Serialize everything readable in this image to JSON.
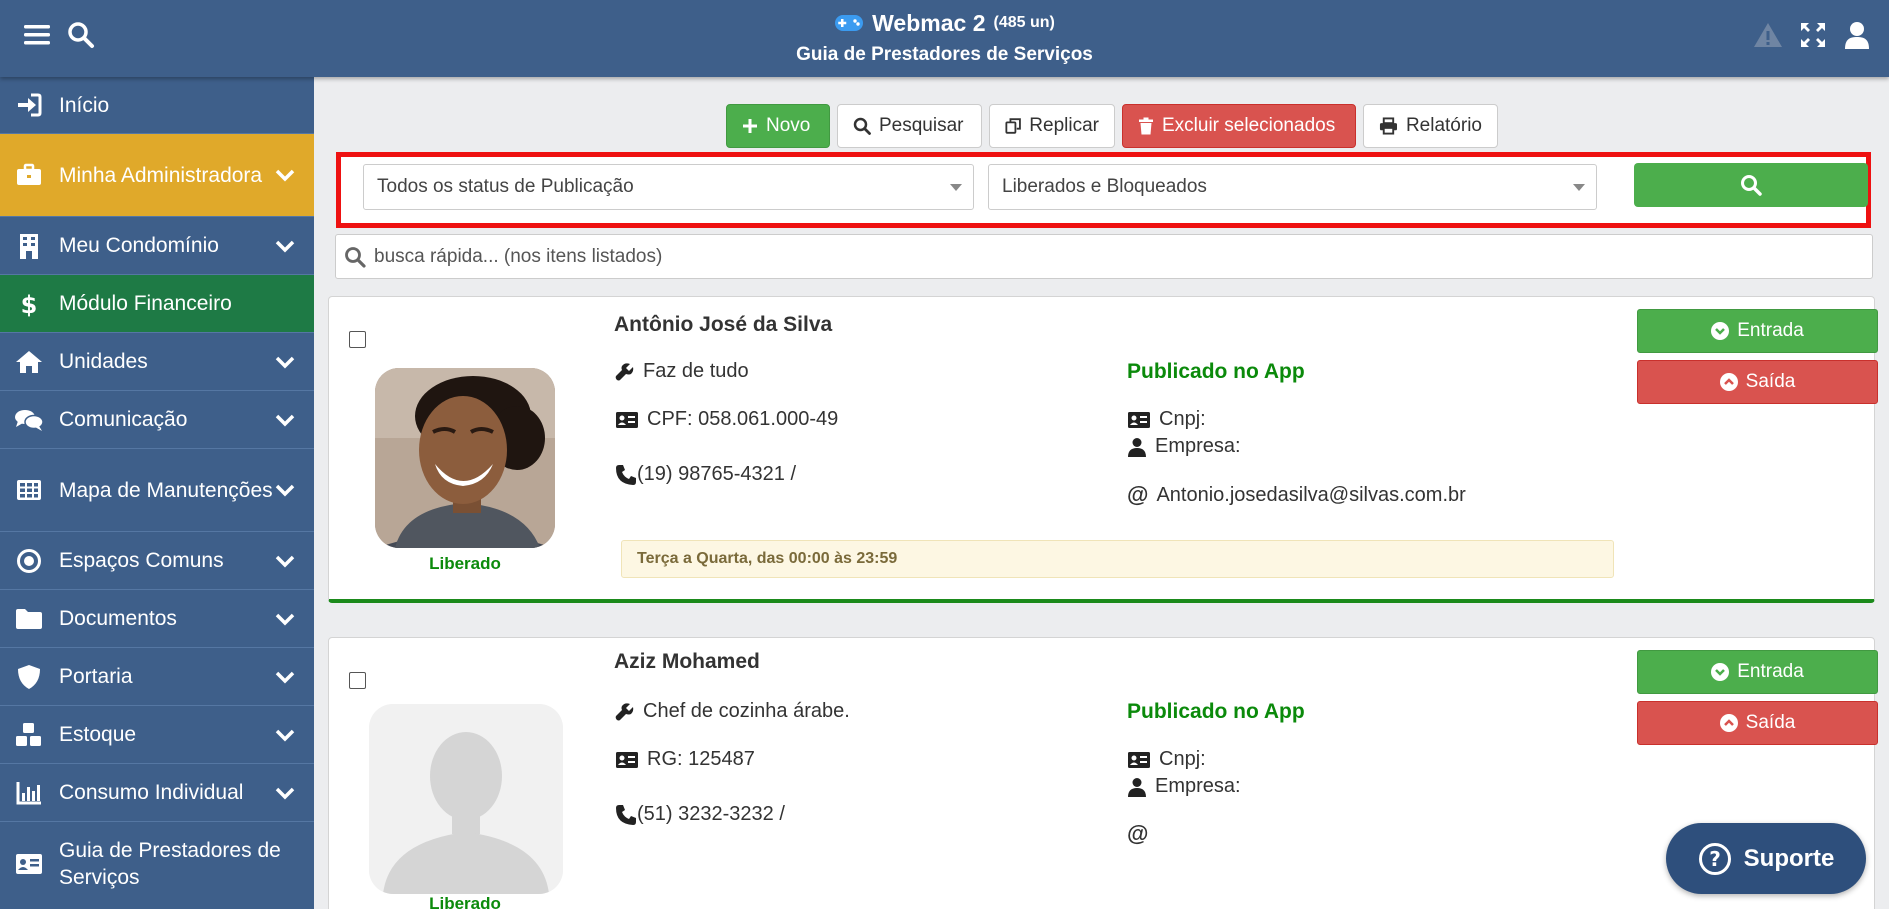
{
  "header": {
    "app_name": "Webmac 2",
    "units": "(485 un)",
    "subtitle": "Guia de Prestadores de Serviços"
  },
  "sidebar": {
    "items": [
      {
        "label": "Início",
        "icon": "sign-in-icon"
      },
      {
        "label": "Minha Administradora",
        "icon": "briefcase-icon",
        "active": true
      },
      {
        "label": "Meu Condomínio",
        "icon": "building-icon"
      },
      {
        "label": "Módulo Financeiro",
        "icon": "dollar-icon"
      },
      {
        "label": "Unidades",
        "icon": "home-icon"
      },
      {
        "label": "Comunicação",
        "icon": "comments-icon"
      },
      {
        "label": "Mapa de Manutenções",
        "icon": "table-icon"
      },
      {
        "label": "Espaços Comuns",
        "icon": "dot-circle-icon"
      },
      {
        "label": "Documentos",
        "icon": "folder-icon"
      },
      {
        "label": "Portaria",
        "icon": "shield-icon"
      },
      {
        "label": "Estoque",
        "icon": "cubes-icon"
      },
      {
        "label": "Consumo Individual",
        "icon": "chart-icon"
      },
      {
        "label": "Guia de Prestadores de Serviços",
        "icon": "id-card-icon"
      }
    ]
  },
  "toolbar": {
    "novo": "Novo",
    "pesquisar": "Pesquisar",
    "replicar": "Replicar",
    "excluir": "Excluir selecionados",
    "relatorio": "Relatório"
  },
  "filters": {
    "status_publicacao": "Todos os status de Publicação",
    "liberacao": "Liberados e Bloqueados"
  },
  "quick_search": {
    "placeholder": "busca rápida... (nos itens listados)"
  },
  "providers": [
    {
      "name": "Antônio José da Silva",
      "service": "Faz de tudo",
      "document": "CPF: 058.061.000-49",
      "phone": "(19) 98765-4321 /",
      "published": "Publicado no App",
      "cnpj": "Cnpj:",
      "empresa": "Empresa:",
      "email": "Antonio.josedasilva@silvas.com.br",
      "schedule": "Terça a Quarta, das 00:00 às 23:59",
      "status": "Liberado",
      "entrada": "Entrada",
      "saida": "Saída"
    },
    {
      "name": "Aziz Mohamed",
      "service": "Chef de cozinha árabe.",
      "document": "RG: 125487",
      "phone": "(51) 3232-3232 /",
      "published": "Publicado no App",
      "cnpj": "Cnpj:",
      "empresa": "Empresa:",
      "email": "",
      "status": "Liberado",
      "entrada": "Entrada",
      "saida": "Saída"
    }
  ],
  "support": {
    "label": "Suporte"
  },
  "colors": {
    "primary": "#3e5f8a",
    "active_menu": "#e0a92a",
    "finance_menu": "#1e7a45",
    "success": "#4cae4c",
    "danger": "#d9534f",
    "highlight_border": "#ee1111"
  }
}
